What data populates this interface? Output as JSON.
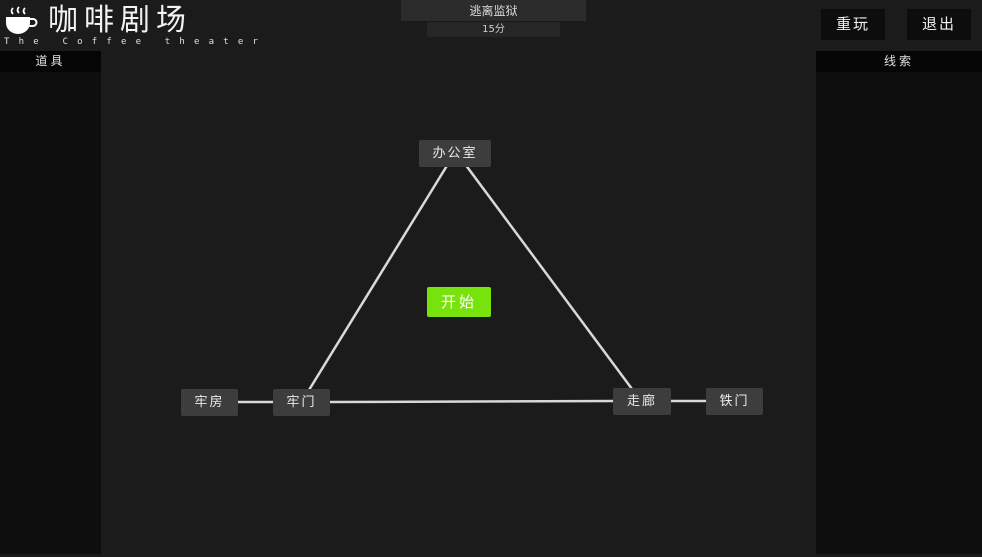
{
  "logo": {
    "title": "咖啡剧场",
    "subtitle": "The Coffee theater"
  },
  "game": {
    "title": "逃离监狱",
    "time": "15分"
  },
  "toolbar": {
    "replay_label": "重玩",
    "exit_label": "退出"
  },
  "panels": {
    "items_title": "道具",
    "clues_title": "线索"
  },
  "map": {
    "nodes": {
      "office": "办公室",
      "cell": "牢房",
      "cell_door": "牢门",
      "corridor": "走廊",
      "iron_door": "铁门"
    },
    "start_label": "开始"
  },
  "colors": {
    "start": "#78e20c",
    "node": "#3d3d3d",
    "path": "#d8d8d8",
    "background": "#1b1b1b"
  }
}
